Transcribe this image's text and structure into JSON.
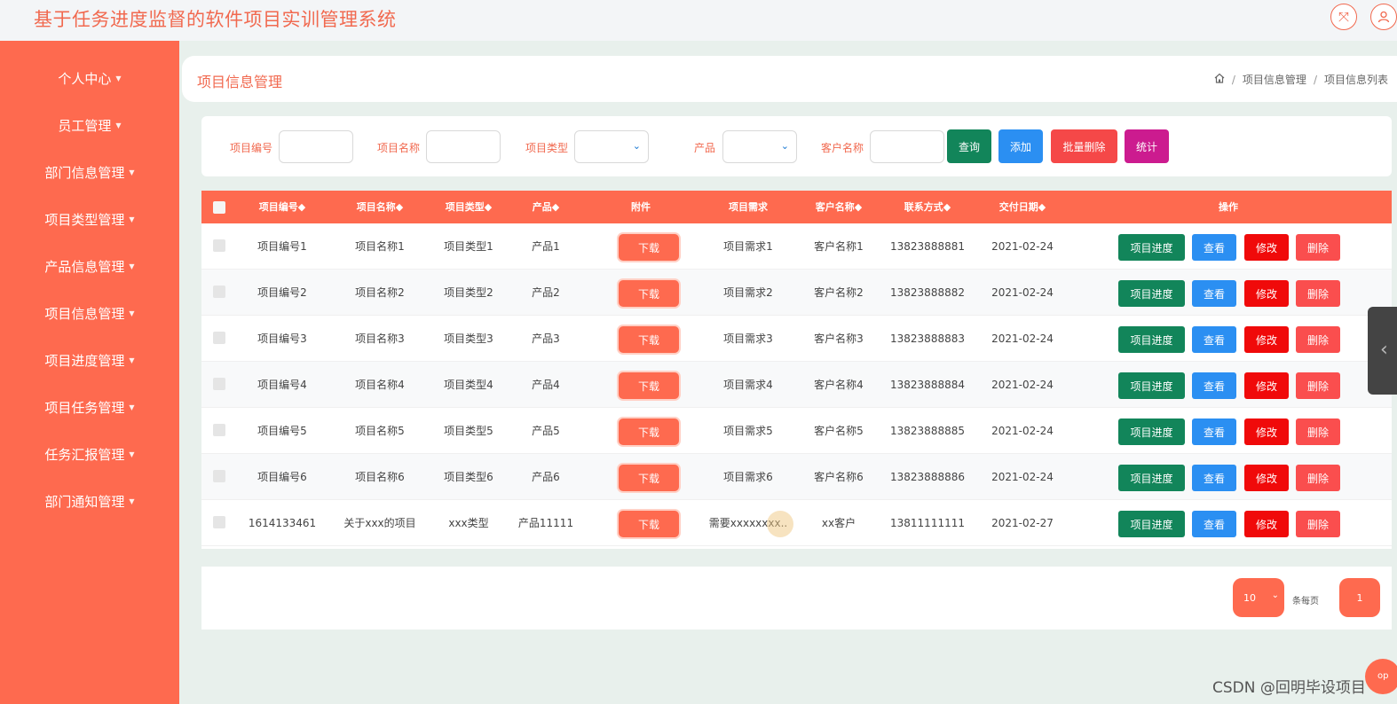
{
  "header": {
    "app_title": "基于任务进度监督的软件项目实训管理系统",
    "icons": [
      "fullscreen-icon",
      "user-icon"
    ]
  },
  "sidebar": {
    "items": [
      {
        "label": "个人中心"
      },
      {
        "label": "员工管理"
      },
      {
        "label": "部门信息管理"
      },
      {
        "label": "项目类型管理"
      },
      {
        "label": "产品信息管理"
      },
      {
        "label": "项目信息管理"
      },
      {
        "label": "项目进度管理"
      },
      {
        "label": "项目任务管理"
      },
      {
        "label": "任务汇报管理"
      },
      {
        "label": "部门通知管理"
      }
    ]
  },
  "page": {
    "title": "项目信息管理",
    "breadcrumb": [
      "项目信息管理",
      "项目信息列表"
    ]
  },
  "search": {
    "labels": {
      "project_no": "项目编号",
      "project_name": "项目名称",
      "project_type": "项目类型",
      "product": "产品",
      "customer_name": "客户名称"
    },
    "values": {
      "project_no": "",
      "project_name": "",
      "project_type": "",
      "product": "",
      "customer_name": ""
    },
    "buttons": {
      "query": "查询",
      "add": "添加",
      "batch_delete": "批量删除",
      "stats": "统计"
    }
  },
  "table": {
    "columns": [
      "项目编号◆",
      "项目名称◆",
      "项目类型◆",
      "产品◆",
      "附件",
      "项目需求",
      "客户名称◆",
      "联系方式◆",
      "交付日期◆",
      "操作"
    ],
    "rows": [
      {
        "no": "项目编号1",
        "name": "项目名称1",
        "type": "项目类型1",
        "product": "产品1",
        "attachment": "下载",
        "requirement": "项目需求1",
        "customer": "客户名称1",
        "phone": "13823888881",
        "date": "2021-02-24"
      },
      {
        "no": "项目编号2",
        "name": "项目名称2",
        "type": "项目类型2",
        "product": "产品2",
        "attachment": "下载",
        "requirement": "项目需求2",
        "customer": "客户名称2",
        "phone": "13823888882",
        "date": "2021-02-24"
      },
      {
        "no": "项目编号3",
        "name": "项目名称3",
        "type": "项目类型3",
        "product": "产品3",
        "attachment": "下载",
        "requirement": "项目需求3",
        "customer": "客户名称3",
        "phone": "13823888883",
        "date": "2021-02-24"
      },
      {
        "no": "项目编号4",
        "name": "项目名称4",
        "type": "项目类型4",
        "product": "产品4",
        "attachment": "下载",
        "requirement": "项目需求4",
        "customer": "客户名称4",
        "phone": "13823888884",
        "date": "2021-02-24"
      },
      {
        "no": "项目编号5",
        "name": "项目名称5",
        "type": "项目类型5",
        "product": "产品5",
        "attachment": "下载",
        "requirement": "项目需求5",
        "customer": "客户名称5",
        "phone": "13823888885",
        "date": "2021-02-24"
      },
      {
        "no": "项目编号6",
        "name": "项目名称6",
        "type": "项目类型6",
        "product": "产品6",
        "attachment": "下载",
        "requirement": "项目需求6",
        "customer": "客户名称6",
        "phone": "13823888886",
        "date": "2021-02-24"
      },
      {
        "no": "1614133461",
        "name": "关于xxx的项目",
        "type": "xxx类型",
        "product": "产品11111",
        "attachment": "下载",
        "requirement": "需要xxxxxxxx..",
        "customer": "xx客户",
        "phone": "13811111111",
        "date": "2021-02-27"
      }
    ],
    "actions": {
      "progress": "项目进度",
      "view": "查看",
      "edit": "修改",
      "delete": "删除"
    }
  },
  "pagination": {
    "page_size": "10",
    "per_page_label": "条每页",
    "current_page": "1"
  },
  "misc": {
    "back_to_top": "op",
    "watermark": "CSDN @回明毕设项目"
  },
  "colors": {
    "primary": "#fe6a4f",
    "green": "#12855a",
    "blue": "#2b8ff2",
    "red": "#f00a0a",
    "pink_delete": "#fa4e4e",
    "magenta": "#cc1b8f"
  }
}
